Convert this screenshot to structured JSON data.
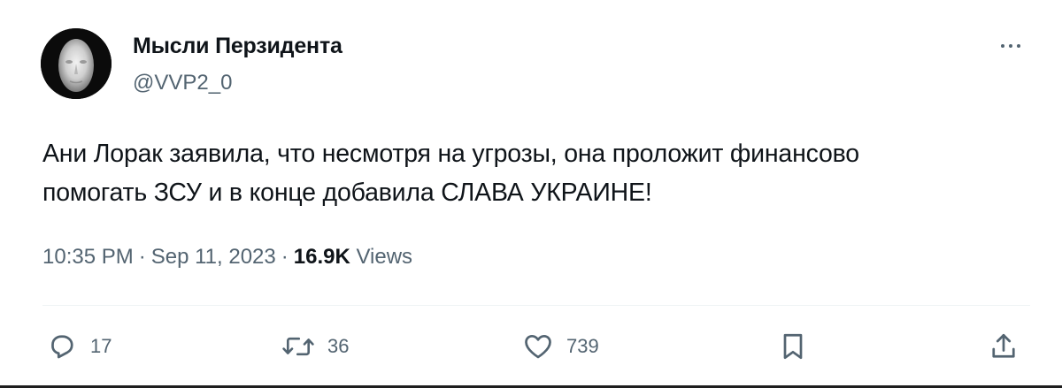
{
  "author": {
    "display_name": "Мысли Перзидента",
    "handle": "@VVP2_0"
  },
  "tweet": {
    "text_lines": [
      "Ани Лорак заявила, что несмотря на угрозы, она проложит финансово",
      "помогать ЗСУ и в конце добавила СЛАВА УКРАИНЕ!"
    ]
  },
  "meta": {
    "time": "10:35 PM",
    "separator": "·",
    "date": "Sep 11, 2023",
    "views_count": "16.9K",
    "views_label": "Views"
  },
  "actions": {
    "reply": {
      "icon": "reply-icon",
      "count": "17"
    },
    "retweet": {
      "icon": "retweet-icon",
      "count": "36"
    },
    "like": {
      "icon": "heart-icon",
      "count": "739"
    },
    "bookmark": {
      "icon": "bookmark-icon"
    },
    "share": {
      "icon": "share-icon"
    }
  },
  "colors": {
    "text_primary": "#0f1419",
    "text_secondary": "#536471",
    "divider": "#eff3f4"
  }
}
